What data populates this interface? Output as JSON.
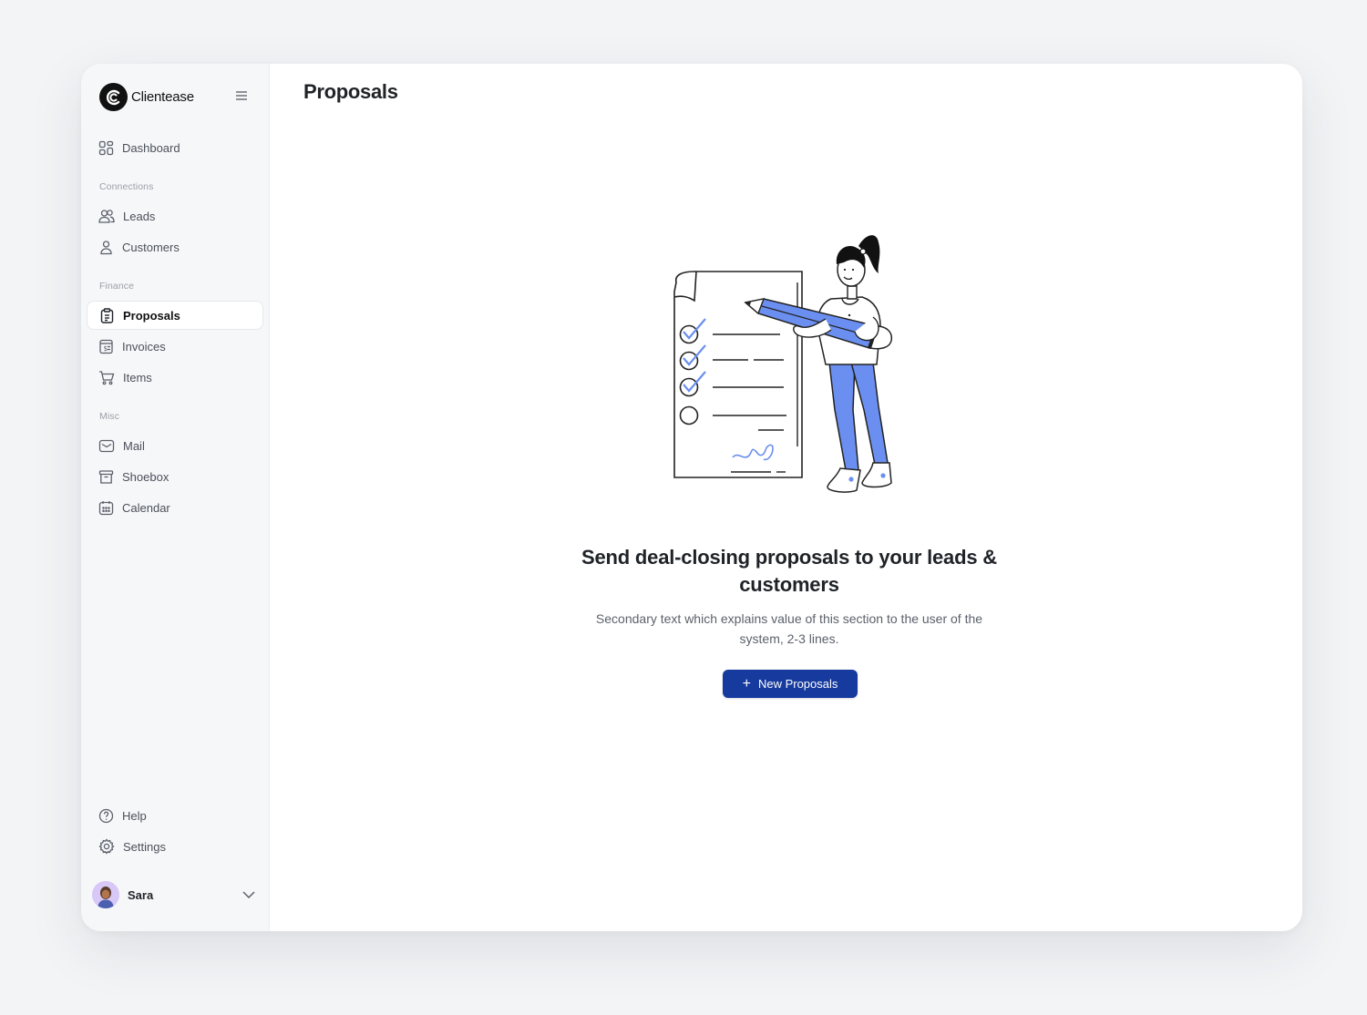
{
  "app": {
    "name": "Clientease"
  },
  "sidebar": {
    "dashboard": {
      "label": "Dashboard",
      "icon": "dashboard-grid-icon"
    },
    "sections": {
      "connections": "Connections",
      "finance": "Finance",
      "misc": "Misc"
    },
    "connections": [
      {
        "label": "Leads",
        "icon": "users-icon"
      },
      {
        "label": "Customers",
        "icon": "user-icon"
      }
    ],
    "finance": [
      {
        "label": "Proposals",
        "icon": "clipboard-icon",
        "active": true
      },
      {
        "label": "Invoices",
        "icon": "invoice-icon"
      },
      {
        "label": "Items",
        "icon": "cart-icon"
      }
    ],
    "misc": [
      {
        "label": "Mail",
        "icon": "mail-icon"
      },
      {
        "label": "Shoebox",
        "icon": "archive-box-icon"
      },
      {
        "label": "Calendar",
        "icon": "calendar-icon"
      }
    ],
    "bottom": [
      {
        "label": "Help",
        "icon": "help-circle-icon"
      },
      {
        "label": "Settings",
        "icon": "gear-icon"
      }
    ],
    "user": {
      "name": "Sara"
    }
  },
  "main": {
    "title": "Proposals",
    "empty_state": {
      "heading": "Send deal-closing proposals to your leads & customers",
      "body": "Secondary text which explains value of this section to the user of the system, 2-3 lines.",
      "cta_label": "New Proposals",
      "cta_icon": "plus-icon"
    }
  },
  "colors": {
    "accent": "#173a9e",
    "illustration_blue": "#6b8ff0",
    "sidebar_bg": "#f6f7f9",
    "page_bg": "#f3f4f6"
  }
}
